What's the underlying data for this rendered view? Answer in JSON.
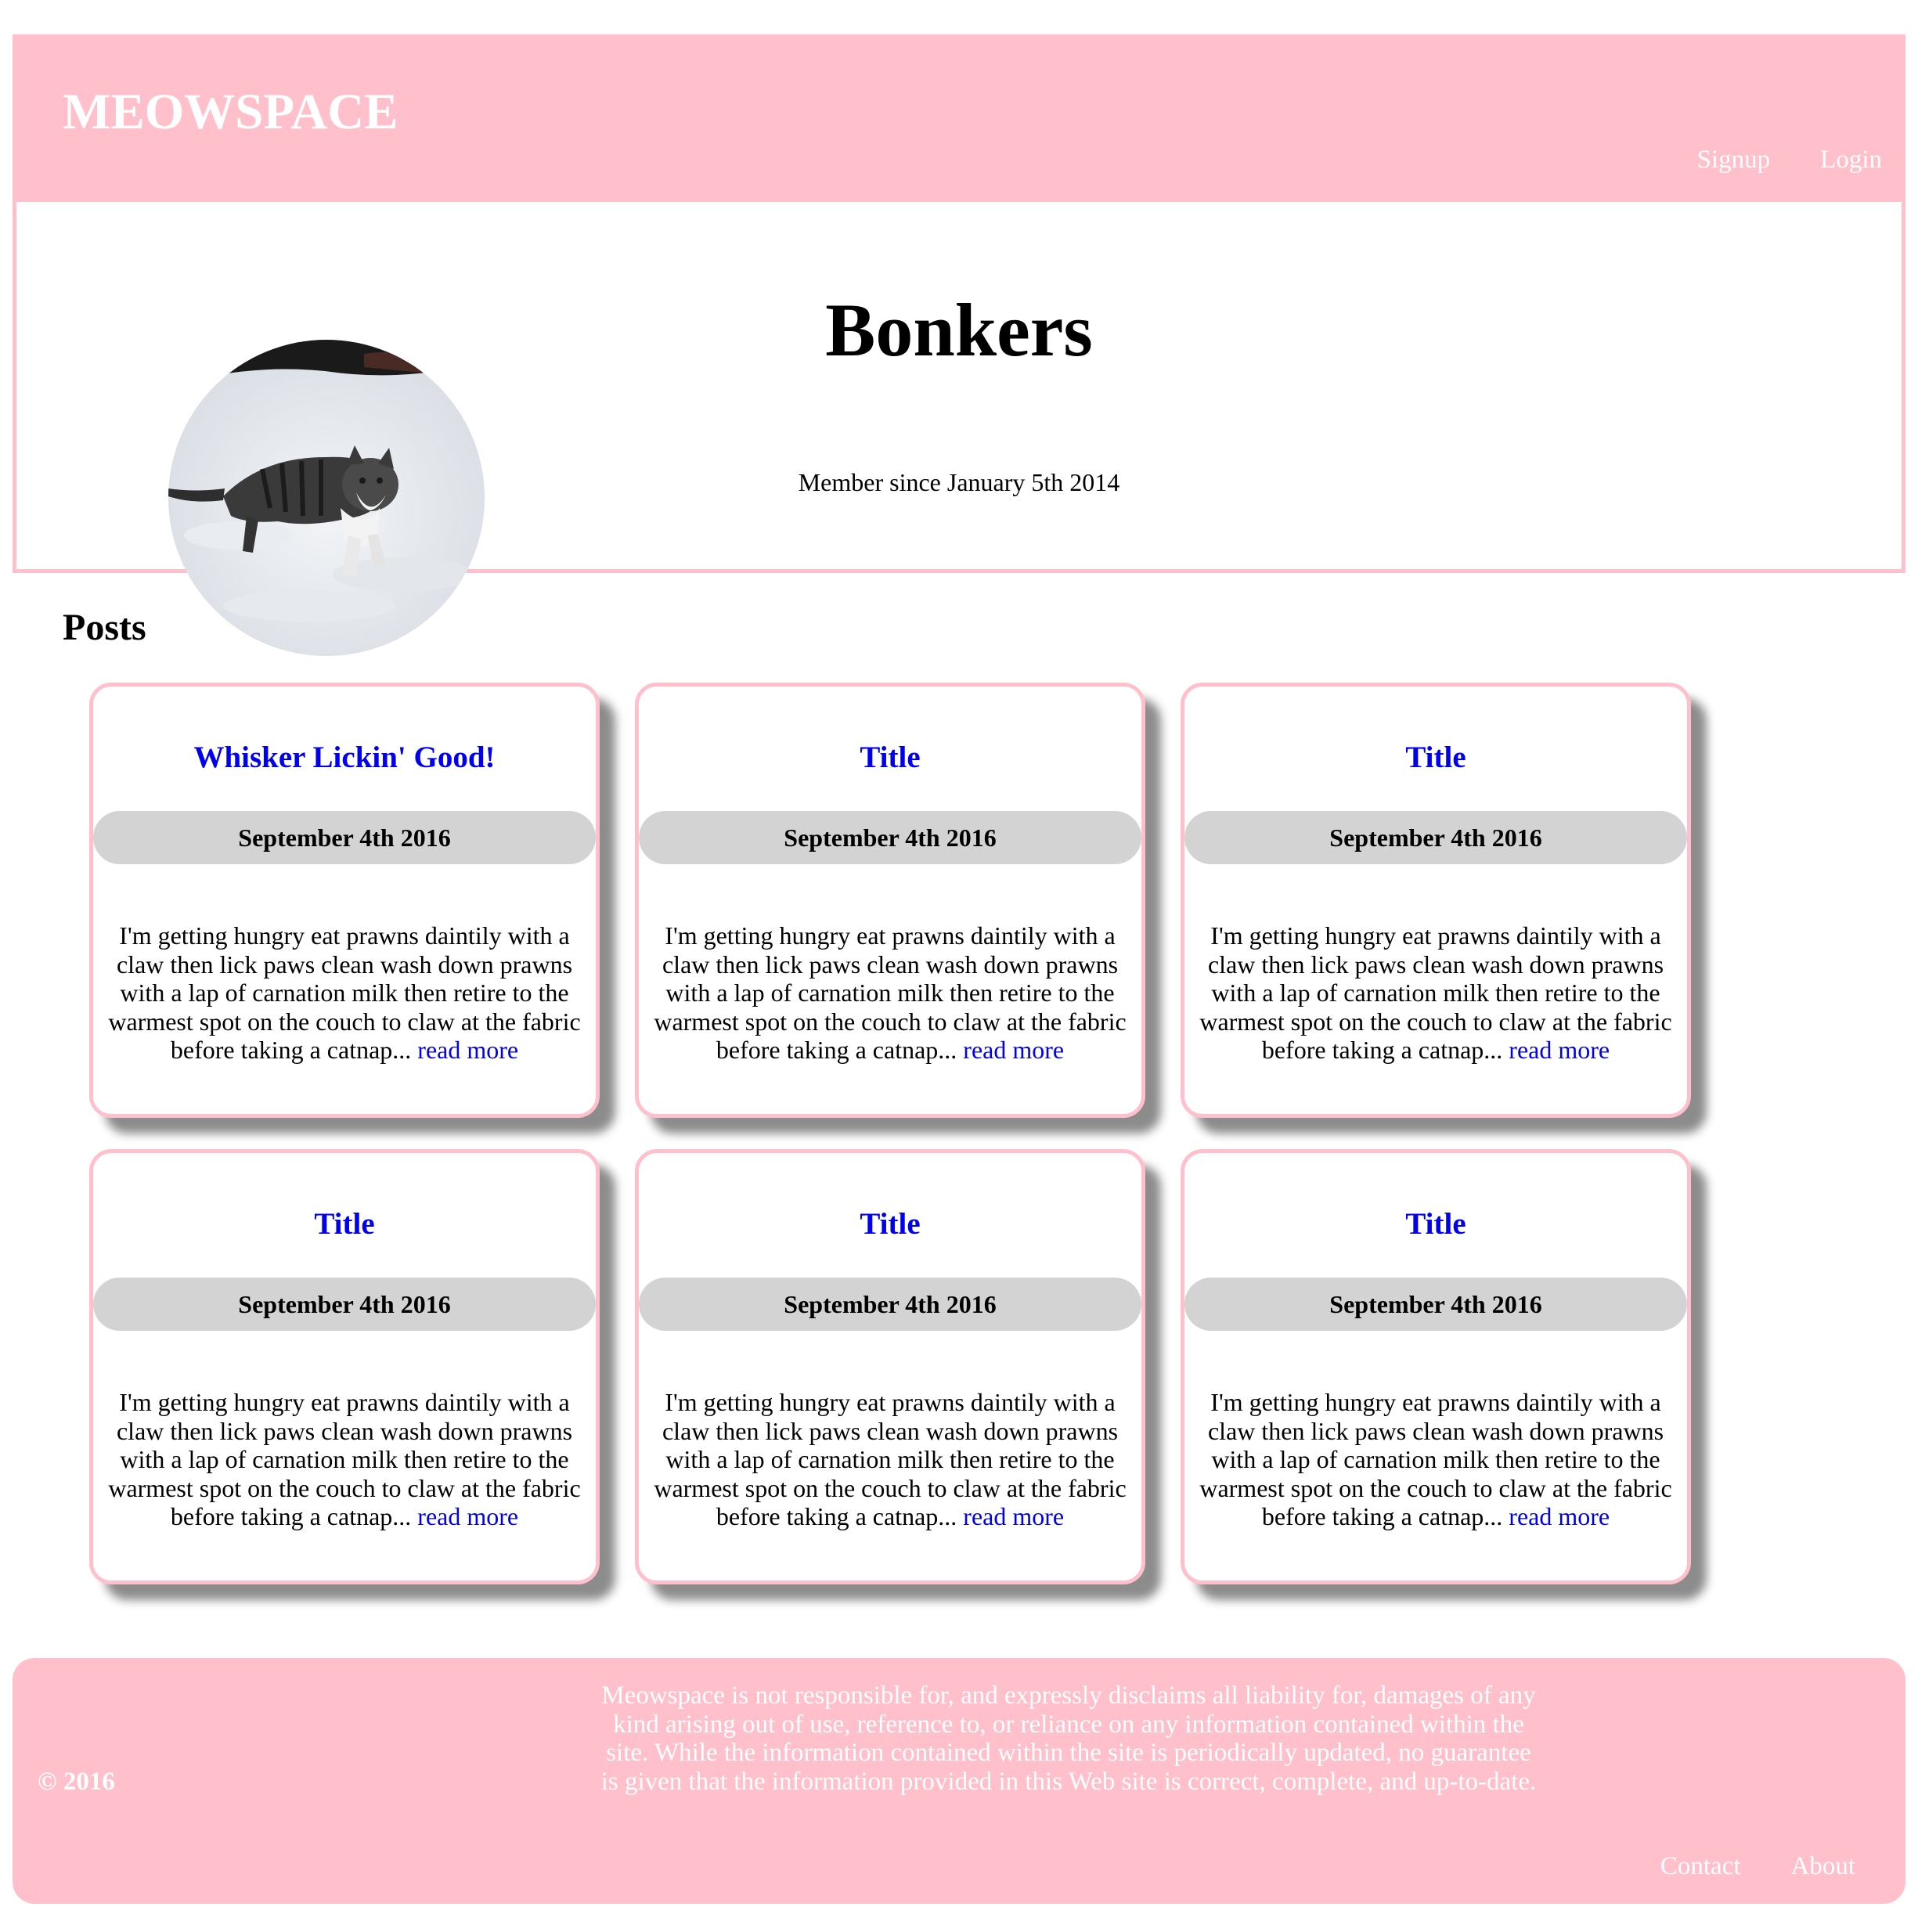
{
  "header": {
    "logo": "MEOWSPACE",
    "nav": {
      "signup": "Signup",
      "login": "Login"
    }
  },
  "profile": {
    "name": "Bonkers",
    "member_since": "Member since January 5th 2014",
    "avatar_alt": "cat-in-snow-photo"
  },
  "posts": {
    "heading": "Posts",
    "items": [
      {
        "title": "Whisker Lickin' Good!",
        "date": "September 4th 2016",
        "excerpt": "I'm getting hungry eat prawns daintily with a claw then lick paws clean wash down prawns with a lap of carnation milk then retire to the warmest spot on the couch to claw at the fabric before taking a catnap...",
        "read_more": "read more"
      },
      {
        "title": "Title",
        "date": "September 4th 2016",
        "excerpt": "I'm getting hungry eat prawns daintily with a claw then lick paws clean wash down prawns with a lap of carnation milk then retire to the warmest spot on the couch to claw at the fabric before taking a catnap...",
        "read_more": "read more"
      },
      {
        "title": "Title",
        "date": "September 4th 2016",
        "excerpt": "I'm getting hungry eat prawns daintily with a claw then lick paws clean wash down prawns with a lap of carnation milk then retire to the warmest spot on the couch to claw at the fabric before taking a catnap...",
        "read_more": "read more"
      },
      {
        "title": "Title",
        "date": "September 4th 2016",
        "excerpt": "I'm getting hungry eat prawns daintily with a claw then lick paws clean wash down prawns with a lap of carnation milk then retire to the warmest spot on the couch to claw at the fabric before taking a catnap...",
        "read_more": "read more"
      },
      {
        "title": "Title",
        "date": "September 4th 2016",
        "excerpt": "I'm getting hungry eat prawns daintily with a claw then lick paws clean wash down prawns with a lap of carnation milk then retire to the warmest spot on the couch to claw at the fabric before taking a catnap...",
        "read_more": "read more"
      },
      {
        "title": "Title",
        "date": "September 4th 2016",
        "excerpt": "I'm getting hungry eat prawns daintily with a claw then lick paws clean wash down prawns with a lap of carnation milk then retire to the warmest spot on the couch to claw at the fabric before taking a catnap...",
        "read_more": "read more"
      }
    ]
  },
  "footer": {
    "copyright": "© 2016",
    "disclaimer": "Meowspace is not responsible for, and expressly disclaims all liability for, damages of any kind arising out of use, reference to, or reliance on any information contained within the site. While the information contained within the site is periodically updated, no guarantee is given that the information provided in this Web site is correct, complete, and up-to-date.",
    "nav": {
      "contact": "Contact",
      "about": "About"
    }
  },
  "colors": {
    "brand_pink": "#ffc0cb",
    "link_blue": "#0000ee",
    "date_bar_gray": "#d3d3d3"
  }
}
